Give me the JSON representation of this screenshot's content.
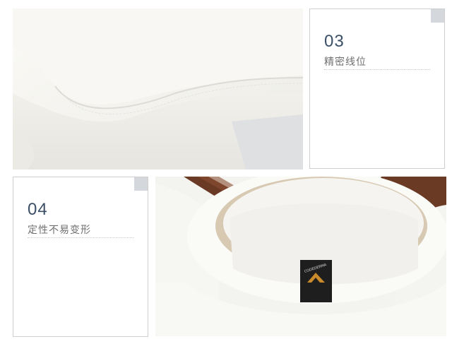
{
  "panels": [
    {
      "number": "03",
      "caption": "精密线位"
    },
    {
      "number": "04",
      "caption": "定性不易变形"
    }
  ],
  "label_tag": {
    "brand_text": "CODEDERMA"
  },
  "colors": {
    "number_text": "#3b4f66",
    "caption_text": "#6f6f6f",
    "card_border": "#cfcfcf",
    "corner_tab": "#d4d7dc"
  }
}
